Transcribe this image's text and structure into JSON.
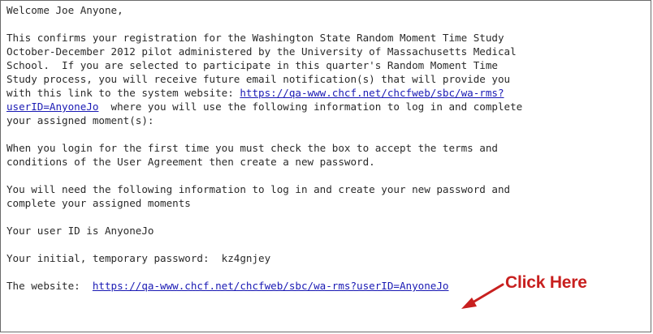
{
  "email": {
    "greeting": "Welcome Joe Anyone,",
    "p1_l1": "This confirms your registration for the Washington State Random Moment Time Study",
    "p1_l2": "October-December 2012 pilot administered by the University of Massachusetts Medical",
    "p1_l3": "School.  If you are selected to participate in this quarter's Random Moment Time",
    "p1_l4": "Study process, you will receive future email notification(s) that will provide you",
    "p1_l5_pre": "with this link to the system website: ",
    "p1_link_part1": "https://qa-www.chcf.net/chcfweb/sbc/wa-rms?",
    "p1_link_part2": "userID=AnyoneJo",
    "p1_l6_post": "  where you will use the following information to log in and complete",
    "p1_l7": "your assigned moment(s):",
    "p2_l1": "When you login for the first time you must check the box to accept the terms and",
    "p2_l2": "conditions of the User Agreement then create a new password.",
    "p3_l1": "You will need the following information to log in and create your new password and",
    "p3_l2": "complete your assigned moments",
    "user_id_line": "Your user ID is AnyoneJo",
    "password_line": "Your initial, temporary password:  kz4gnjey",
    "website_label": "The website:  ",
    "website_link": "https://qa-www.chcf.net/chcfweb/sbc/wa-rms?userID=AnyoneJo"
  },
  "annotation": {
    "callout_text": "Click Here",
    "color": "#c8201f",
    "icon": "arrow-icon"
  },
  "colors": {
    "link": "#1a1ab4",
    "text": "#2a2a2a",
    "border": "#6b6b6b"
  }
}
